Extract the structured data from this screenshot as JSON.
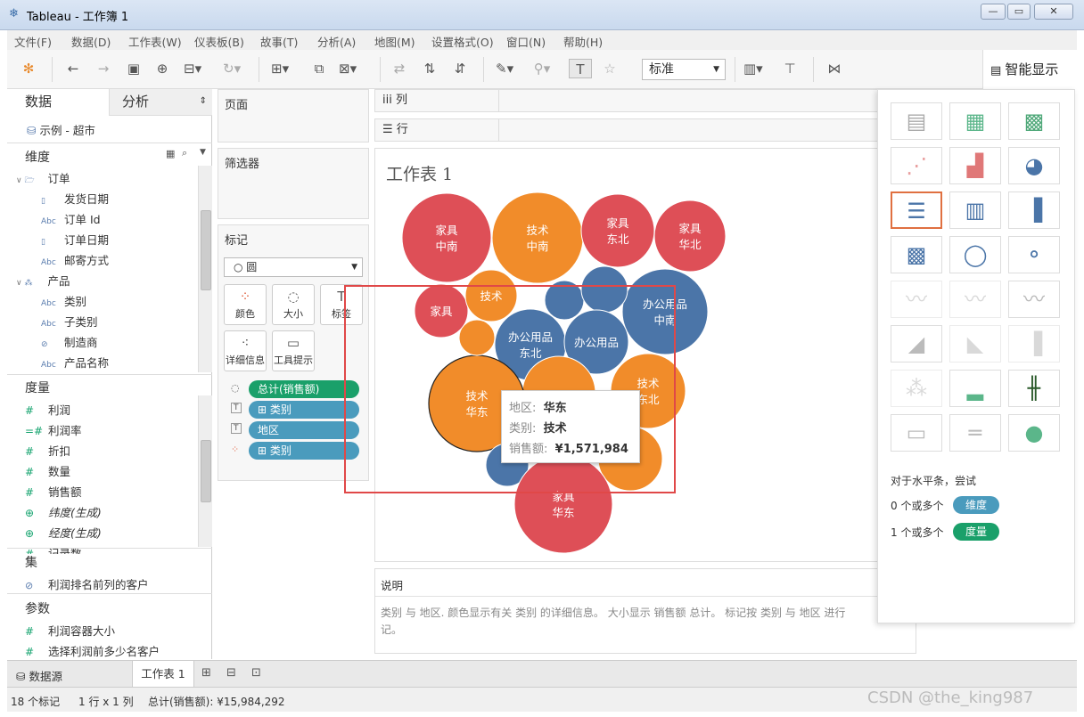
{
  "window": {
    "title": "Tableau - 工作簿 1"
  },
  "menu": [
    "文件(F)",
    "数据(D)",
    "工作表(W)",
    "仪表板(B)",
    "故事(T)",
    "分析(A)",
    "地图(M)",
    "设置格式(O)",
    "窗口(N)",
    "帮助(H)"
  ],
  "toolbar": {
    "fit_select": "标准",
    "smart_show": "智能显示"
  },
  "left": {
    "tab_data": "数据",
    "tab_analysis": "分析",
    "datasource": "示例 - 超市",
    "dimensions_label": "维度",
    "dimensions": [
      {
        "icon": "folder",
        "label": "订单",
        "indent": 0
      },
      {
        "icon": "date",
        "label": "发货日期",
        "indent": 1
      },
      {
        "icon": "abc",
        "label": "订单 Id",
        "indent": 1
      },
      {
        "icon": "date",
        "label": "订单日期",
        "indent": 1
      },
      {
        "icon": "abc",
        "label": "邮寄方式",
        "indent": 1
      },
      {
        "icon": "hier",
        "label": "产品",
        "indent": 0
      },
      {
        "icon": "abc",
        "label": "类别",
        "indent": 1
      },
      {
        "icon": "abc",
        "label": "子类别",
        "indent": 1
      },
      {
        "icon": "clip",
        "label": "制造商",
        "indent": 1
      },
      {
        "icon": "abc",
        "label": "产品名称",
        "indent": 1
      }
    ],
    "measures_label": "度量",
    "measures": [
      {
        "icon": "#",
        "label": "利润"
      },
      {
        "icon": "=#",
        "label": "利润率"
      },
      {
        "icon": "#",
        "label": "折扣"
      },
      {
        "icon": "#",
        "label": "数量"
      },
      {
        "icon": "#",
        "label": "销售额"
      },
      {
        "icon": "globe",
        "label": "纬度(生成)"
      },
      {
        "icon": "globe",
        "label": "经度(生成)"
      },
      {
        "icon": "#",
        "label": "记录数"
      }
    ],
    "sets_label": "集",
    "sets": [
      "利润排名前列的客户"
    ],
    "params_label": "参数",
    "params": [
      "利润容器大小",
      "选择利润前多少名客户"
    ]
  },
  "shelves": {
    "pages": "页面",
    "filters": "筛选器",
    "marks": "标记",
    "mark_type": "圆",
    "mark_buttons": [
      "颜色",
      "大小",
      "标签",
      "详细信息",
      "工具提示"
    ],
    "pills": [
      {
        "icon": "size",
        "label": "总计(销售额)",
        "color": "#1aa06a"
      },
      {
        "icon": "T",
        "label": "⊞ 类别",
        "color": "#4a9bbd"
      },
      {
        "icon": "T",
        "label": "地区",
        "color": "#4a9bbd"
      },
      {
        "icon": "color",
        "label": "⊞ 类别",
        "color": "#4a9bbd"
      }
    ],
    "columns": "列",
    "rows": "行"
  },
  "sheet": {
    "title": "工作表 1"
  },
  "chart_data": {
    "type": "packed-bubble",
    "size_measure": "销售额",
    "color_by": "类别",
    "label_fields": [
      "类别",
      "地区"
    ],
    "colors": {
      "家具": "#de4f57",
      "技术": "#f18c2a",
      "办公用品": "#4b75a8"
    },
    "bubbles": [
      {
        "cat": "家具",
        "region": "中南",
        "lines": [
          "家具",
          "中南"
        ]
      },
      {
        "cat": "技术",
        "region": "中南",
        "lines": [
          "技术",
          "中南"
        ]
      },
      {
        "cat": "家具",
        "region": "东北",
        "lines": [
          "家具",
          "东北"
        ]
      },
      {
        "cat": "家具",
        "region": "华北",
        "lines": [
          "家具",
          "华北"
        ]
      },
      {
        "cat": "办公用品",
        "region": "中南",
        "lines": [
          "办公用品",
          "中南"
        ]
      },
      {
        "cat": "家具",
        "region": "",
        "lines": [
          "家具"
        ]
      },
      {
        "cat": "技术",
        "region": "",
        "lines": [
          "技术"
        ]
      },
      {
        "cat": "办公用品",
        "region": "",
        "lines": []
      },
      {
        "cat": "办公用品",
        "region": "",
        "lines": []
      },
      {
        "cat": "办公用品",
        "region": "东北",
        "lines": [
          "办公用品",
          "东北"
        ]
      },
      {
        "cat": "办公用品",
        "region": "",
        "lines": [
          "办公用品"
        ]
      },
      {
        "cat": "技术",
        "region": "",
        "lines": []
      },
      {
        "cat": "技术",
        "region": "华东",
        "lines": [
          "技术",
          "华东"
        ],
        "highlight": true
      },
      {
        "cat": "办公用品",
        "region": "",
        "lines": []
      },
      {
        "cat": "技术",
        "region": "东北",
        "lines": [
          "技术",
          "东北"
        ]
      },
      {
        "cat": "家具",
        "region": "",
        "lines": [
          "家具"
        ]
      },
      {
        "cat": "技术",
        "region": "",
        "lines": []
      },
      {
        "cat": "家具",
        "region": "华东",
        "lines": [
          "家具",
          "华东"
        ]
      }
    ]
  },
  "tooltip": {
    "rows": [
      {
        "k": "地区:",
        "v": "华东"
      },
      {
        "k": "类别:",
        "v": "技术"
      },
      {
        "k": "销售额:",
        "v": "¥1,571,984"
      }
    ]
  },
  "description": {
    "title": "说明",
    "text": "类别 与 地区. 颜色显示有关 类别 的详细信息。 大小显示 销售额 总计。 标记按 类别 与 地区 进行",
    "text2": "记。"
  },
  "smart": {
    "hint": "对于水平条，尝试",
    "dim_prefix": "0 个或多个",
    "dim_pill": "维度",
    "mea_prefix": "1 个或多个",
    "mea_pill": "度量"
  },
  "bottom": {
    "datasource_tab": "数据源",
    "sheet_tab": "工作表 1"
  },
  "status": {
    "marks": "18 个标记",
    "rowscols": "1 行 x 1 列",
    "sum": "总计(销售额): ¥15,984,292"
  },
  "watermark": "CSDN @the_king987"
}
